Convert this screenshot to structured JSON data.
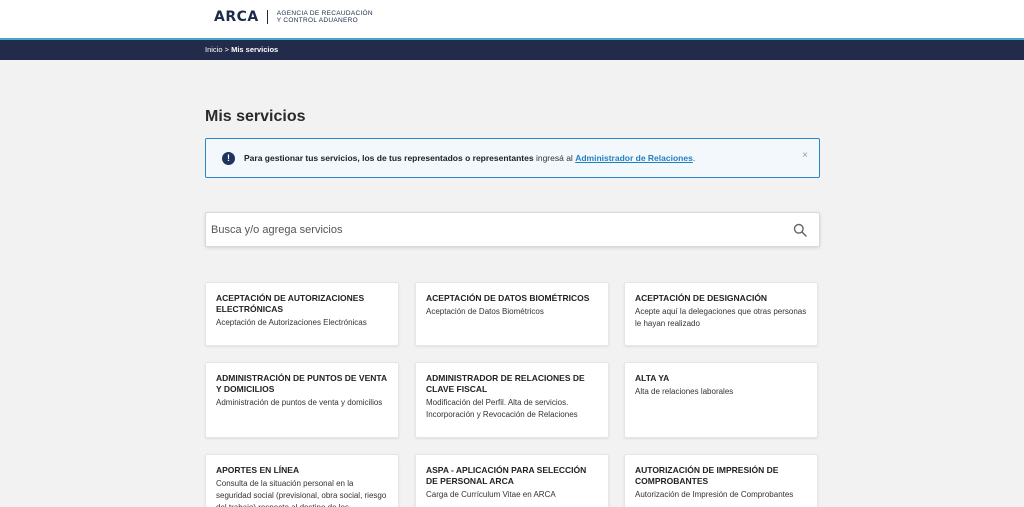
{
  "header": {
    "logo_word": "ARCA",
    "logo_sub_line1": "AGENCIA DE RECAUDACIÓN",
    "logo_sub_line2": "Y CONTROL ADUANERO"
  },
  "breadcrumb": {
    "home": "Inicio",
    "separator": ">",
    "current": "Mis servicios"
  },
  "page_title": "Mis servicios",
  "alert": {
    "bold_text": "Para gestionar tus servicios, los de tus representados o representantes",
    "normal_text": " ingresá al ",
    "link_text": "Administrador de Relaciones",
    "suffix": ".",
    "close_label": "×"
  },
  "search": {
    "placeholder": "Busca y/o agrega servicios",
    "value": ""
  },
  "colors": {
    "topbar": "#232b4b",
    "accent_line": "#46a7d0",
    "alert_border": "#2e86c5",
    "link": "#1f7fc2"
  },
  "services": [
    {
      "title": "ACEPTACIÓN DE AUTORIZACIONES ELECTRÓNICAS",
      "desc": "Aceptación de Autorizaciones Electrónicas"
    },
    {
      "title": "ACEPTACIÓN DE DATOS BIOMÉTRICOS",
      "desc": "Aceptación de Datos Biométricos"
    },
    {
      "title": "ACEPTACIÓN DE DESIGNACIÓN",
      "desc": "Acepte aquí la delegaciones que otras personas le hayan realizado"
    },
    {
      "title": "ADMINISTRACIÓN DE PUNTOS DE VENTA Y DOMICILIOS",
      "desc": "Administración de puntos de venta y domicilios"
    },
    {
      "title": "ADMINISTRADOR DE RELACIONES DE CLAVE FISCAL",
      "desc": "Modificación del Perfil. Alta de servicios. Incorporación y Revocación de Relaciones"
    },
    {
      "title": "ALTA YA",
      "desc": "Alta de relaciones laborales"
    },
    {
      "title": "APORTES EN LÍNEA",
      "desc": "Consulta de la situación personal en la seguridad social (previsional, obra social, riesgo del trabajo) respecto al destino de los"
    },
    {
      "title": "ASPA - APLICACIÓN PARA SELECCIÓN DE PERSONAL ARCA",
      "desc": "Carga de Currículum Vitae en ARCA"
    },
    {
      "title": "AUTORIZACIÓN DE IMPRESIÓN DE COMPROBANTES",
      "desc": "Autorización de Impresión de Comprobantes"
    }
  ]
}
